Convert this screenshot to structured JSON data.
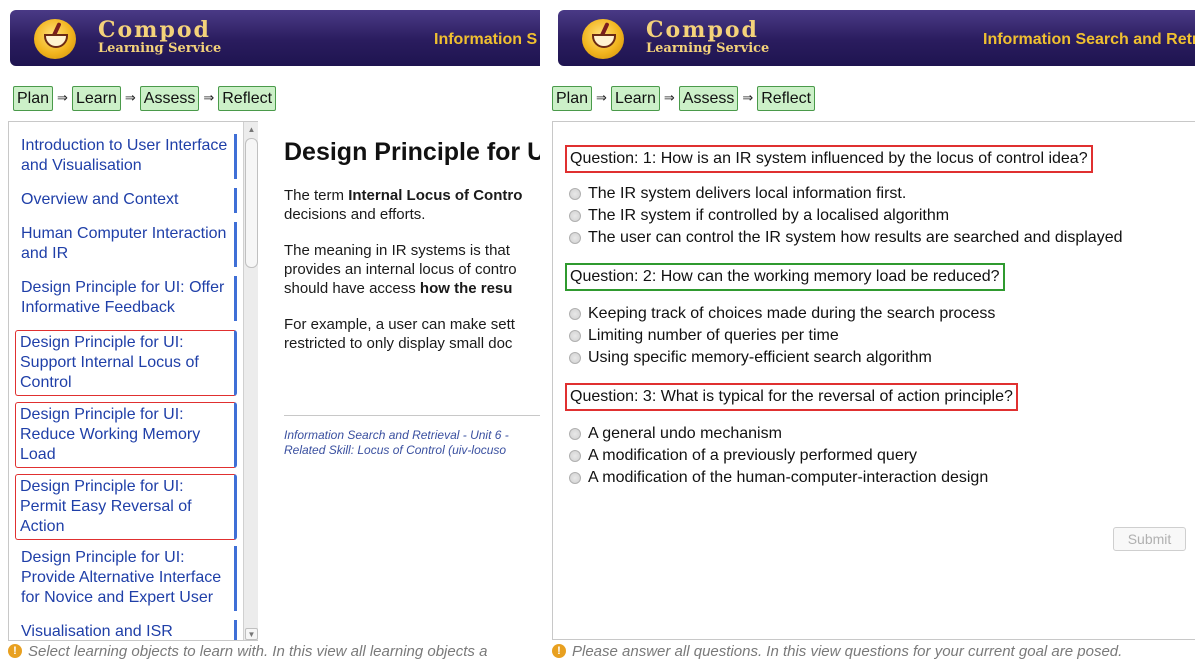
{
  "brand": {
    "name": "Compod",
    "sub": "Learning Service"
  },
  "left": {
    "header_title": "Information S",
    "steps": [
      "Plan",
      "Learn",
      "Assess",
      "Reflect"
    ],
    "learning_objects": [
      {
        "label": "Introduction to User Interface and Visualisation"
      },
      {
        "label": "Overview and Context"
      },
      {
        "label": "Human Computer Interaction and IR"
      },
      {
        "label": "Design Principle for UI: Offer Informative Feedback"
      },
      {
        "label": "Design Principle for UI: Support Internal Locus of Control"
      },
      {
        "label": "Design Principle for UI: Reduce Working Memory Load"
      },
      {
        "label": "Design Principle for UI: Permit Easy Reversal of Action"
      },
      {
        "label": "Design Principle for UI: Provide Alternative Interface for Novice and Expert User"
      },
      {
        "label": "Visualisation and ISR"
      }
    ],
    "content": {
      "title": "Design Principle for U",
      "p1_pre": "The term ",
      "p1_bold": "Internal Locus of Contro",
      "p1_line2": "decisions and efforts.",
      "p2_line1": "The meaning in IR systems is that",
      "p2_line2": "provides an internal locus of contro",
      "p2_line3_pre": "should have access ",
      "p2_line3_bold": "how the resu",
      "p3_line1": "For example, a user can make sett",
      "p3_line2": "restricted to only display small doc",
      "meta_line1": "Information Search and Retrieval - Unit 6 -",
      "meta_line2": "Related Skill: Locus of Control (uiv-locuso"
    },
    "status": "Select learning objects to learn with. In this view all learning objects a"
  },
  "right": {
    "header_title": "Information Search and Retr",
    "steps": [
      "Plan",
      "Learn",
      "Assess",
      "Reflect"
    ],
    "questions": [
      {
        "text": "Question: 1: How is an IR system influenced by the locus of control idea?",
        "options": [
          "The IR system delivers local information first.",
          "The IR system if controlled by a localised algorithm",
          "The user can control the IR system how results are searched and displayed"
        ]
      },
      {
        "text": "Question: 2: How can the working memory load be reduced?",
        "options": [
          "Keeping track of choices made during the search process",
          "Limiting number of queries per time",
          "Using specific memory-efficient search algorithm"
        ]
      },
      {
        "text": "Question: 3: What is typical for the reversal of action principle?",
        "options": [
          "A general undo mechanism",
          "A modification of a previously performed query",
          "A modification of the human-computer-interaction design"
        ]
      }
    ],
    "submit_label": "Submit",
    "status": "Please answer all questions. In this view questions for your current goal are posed."
  },
  "colors": {
    "header_bg": "#2a1c5e",
    "brand_text": "#f4d27a",
    "step_bg": "#ccf0c8",
    "link": "#1f3fa8",
    "wrong_outline": "#e03030",
    "right_outline": "#2f9a2f"
  }
}
